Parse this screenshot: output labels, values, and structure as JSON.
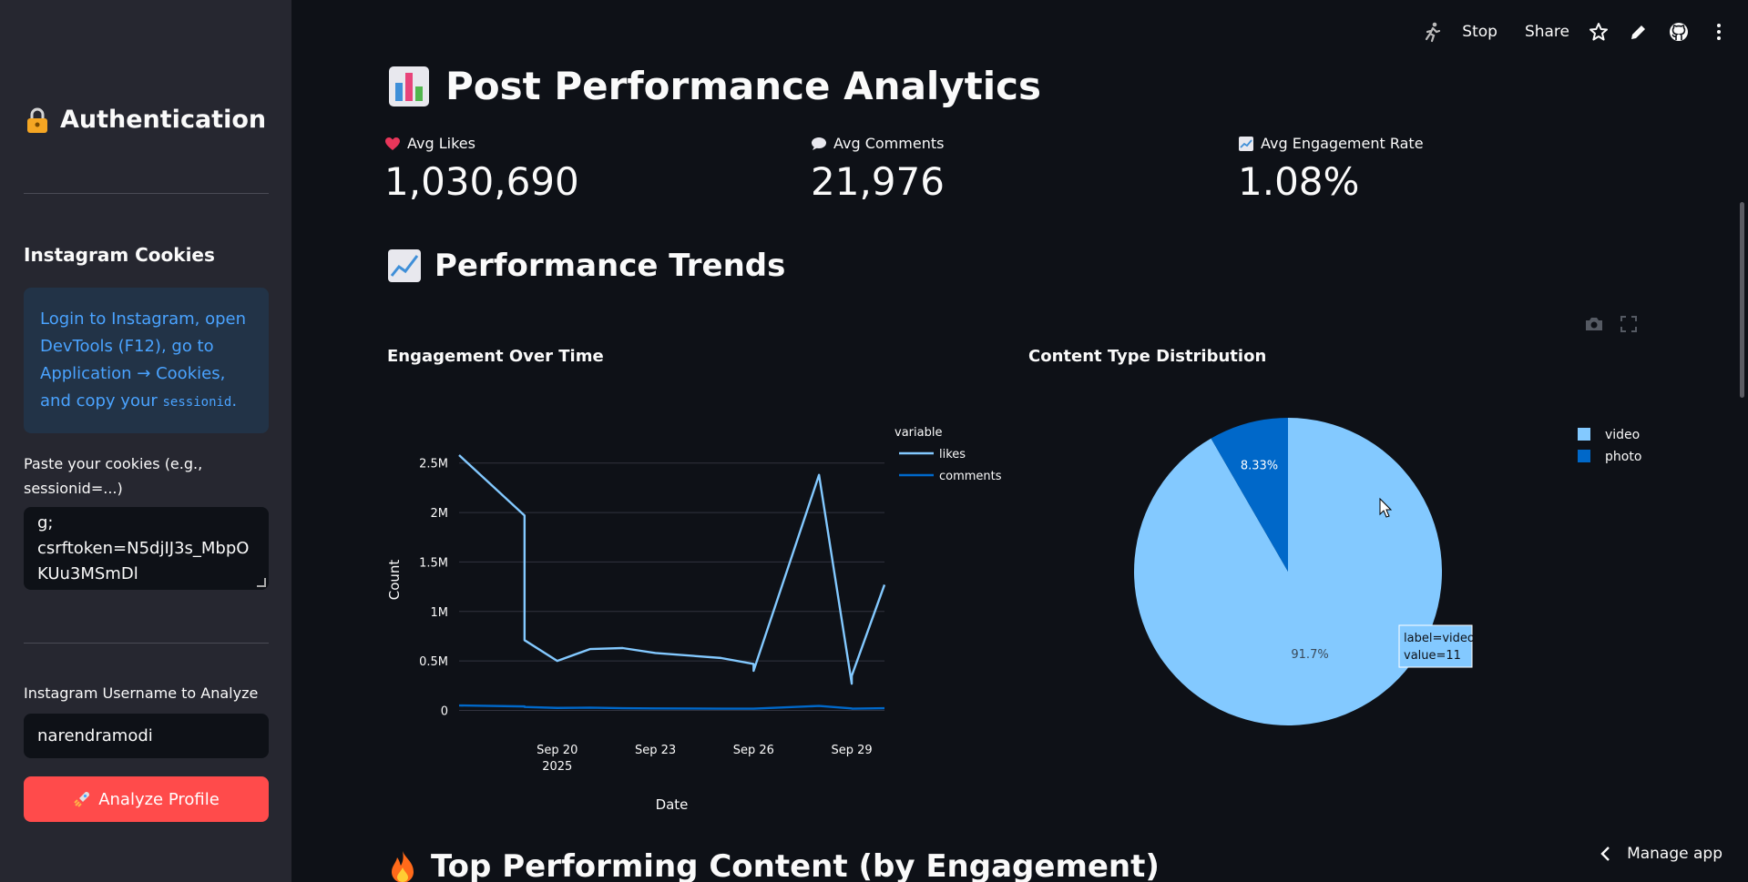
{
  "sidebar": {
    "auth_title": "Authentication",
    "cookies_heading": "Instagram Cookies",
    "info_text_1": "Login to Instagram, open DevTools (F12), go to Application → Cookies, and copy your ",
    "info_code": "sessionid",
    "info_text_2": ".",
    "paste_label": "Paste your cookies (e.g., sessionid=...)",
    "cookie_line_1": "g;",
    "cookie_line_2": "csrftoken=N5djIJ3s_MbpO",
    "cookie_line_3": "KUu3MSmDl",
    "username_label": "Instagram Username to Analyze",
    "username_value": "narendramodi",
    "analyze_label": "Analyze Profile"
  },
  "toolbar": {
    "stop_label": "Stop",
    "share_label": "Share"
  },
  "main": {
    "title": "Post Performance Analytics",
    "metrics": [
      {
        "label": "Avg Likes",
        "value": "1,030,690"
      },
      {
        "label": "Avg Comments",
        "value": "21,976"
      },
      {
        "label": "Avg Engagement Rate",
        "value": "1.08%"
      }
    ],
    "trends_title": "Performance Trends",
    "top_content_title": "Top Performing Content (by Engagement)"
  },
  "manage_app_label": "Manage app",
  "colors": {
    "likes": "#83c9ff",
    "comments": "#0068c9",
    "accent": "#ff4b4b"
  },
  "chart_data": [
    {
      "type": "line",
      "title": "Engagement Over Time",
      "xlabel": "Date",
      "ylabel": "Count",
      "legend_title": "variable",
      "x_tick_labels": [
        "Sep 20\n2025",
        "Sep 23",
        "Sep 26",
        "Sep 29"
      ],
      "y_tick_labels": [
        "0",
        "0.5M",
        "1M",
        "1.5M",
        "2M",
        "2.5M"
      ],
      "xlim": [
        "2025-09-17",
        "2025-09-30"
      ],
      "ylim": [
        -60000,
        2700000
      ],
      "x": [
        "2025-09-17",
        "2025-09-19",
        "2025-09-19",
        "2025-09-20",
        "2025-09-21",
        "2025-09-22",
        "2025-09-23",
        "2025-09-25",
        "2025-09-26",
        "2025-09-26",
        "2025-09-28",
        "2025-09-29",
        "2025-09-29",
        "2025-09-30",
        "2025-09-30",
        "2025-09-30",
        "2025-09-30"
      ],
      "series": [
        {
          "name": "likes",
          "values": [
            2580000,
            1970000,
            710000,
            500000,
            620000,
            630000,
            580000,
            530000,
            470000,
            400000,
            2380000,
            270000,
            350000,
            1270000,
            1270000,
            1270000,
            1270000
          ]
        },
        {
          "name": "comments",
          "values": [
            50000,
            40000,
            35000,
            25000,
            28000,
            22000,
            20000,
            18000,
            18000,
            18000,
            45000,
            20000,
            18000,
            22000,
            22000,
            22000,
            22000
          ]
        }
      ],
      "grid": true,
      "legend_position": "top-right"
    },
    {
      "type": "pie",
      "title": "Content Type Distribution",
      "labels": [
        "video",
        "photo"
      ],
      "values": [
        11,
        1
      ],
      "percent_labels": [
        "91.7%",
        "8.33%"
      ],
      "colors": [
        "#83c9ff",
        "#0068c9"
      ],
      "tooltip_lines": [
        "label=video",
        "value=11"
      ],
      "legend_position": "top-right"
    }
  ]
}
